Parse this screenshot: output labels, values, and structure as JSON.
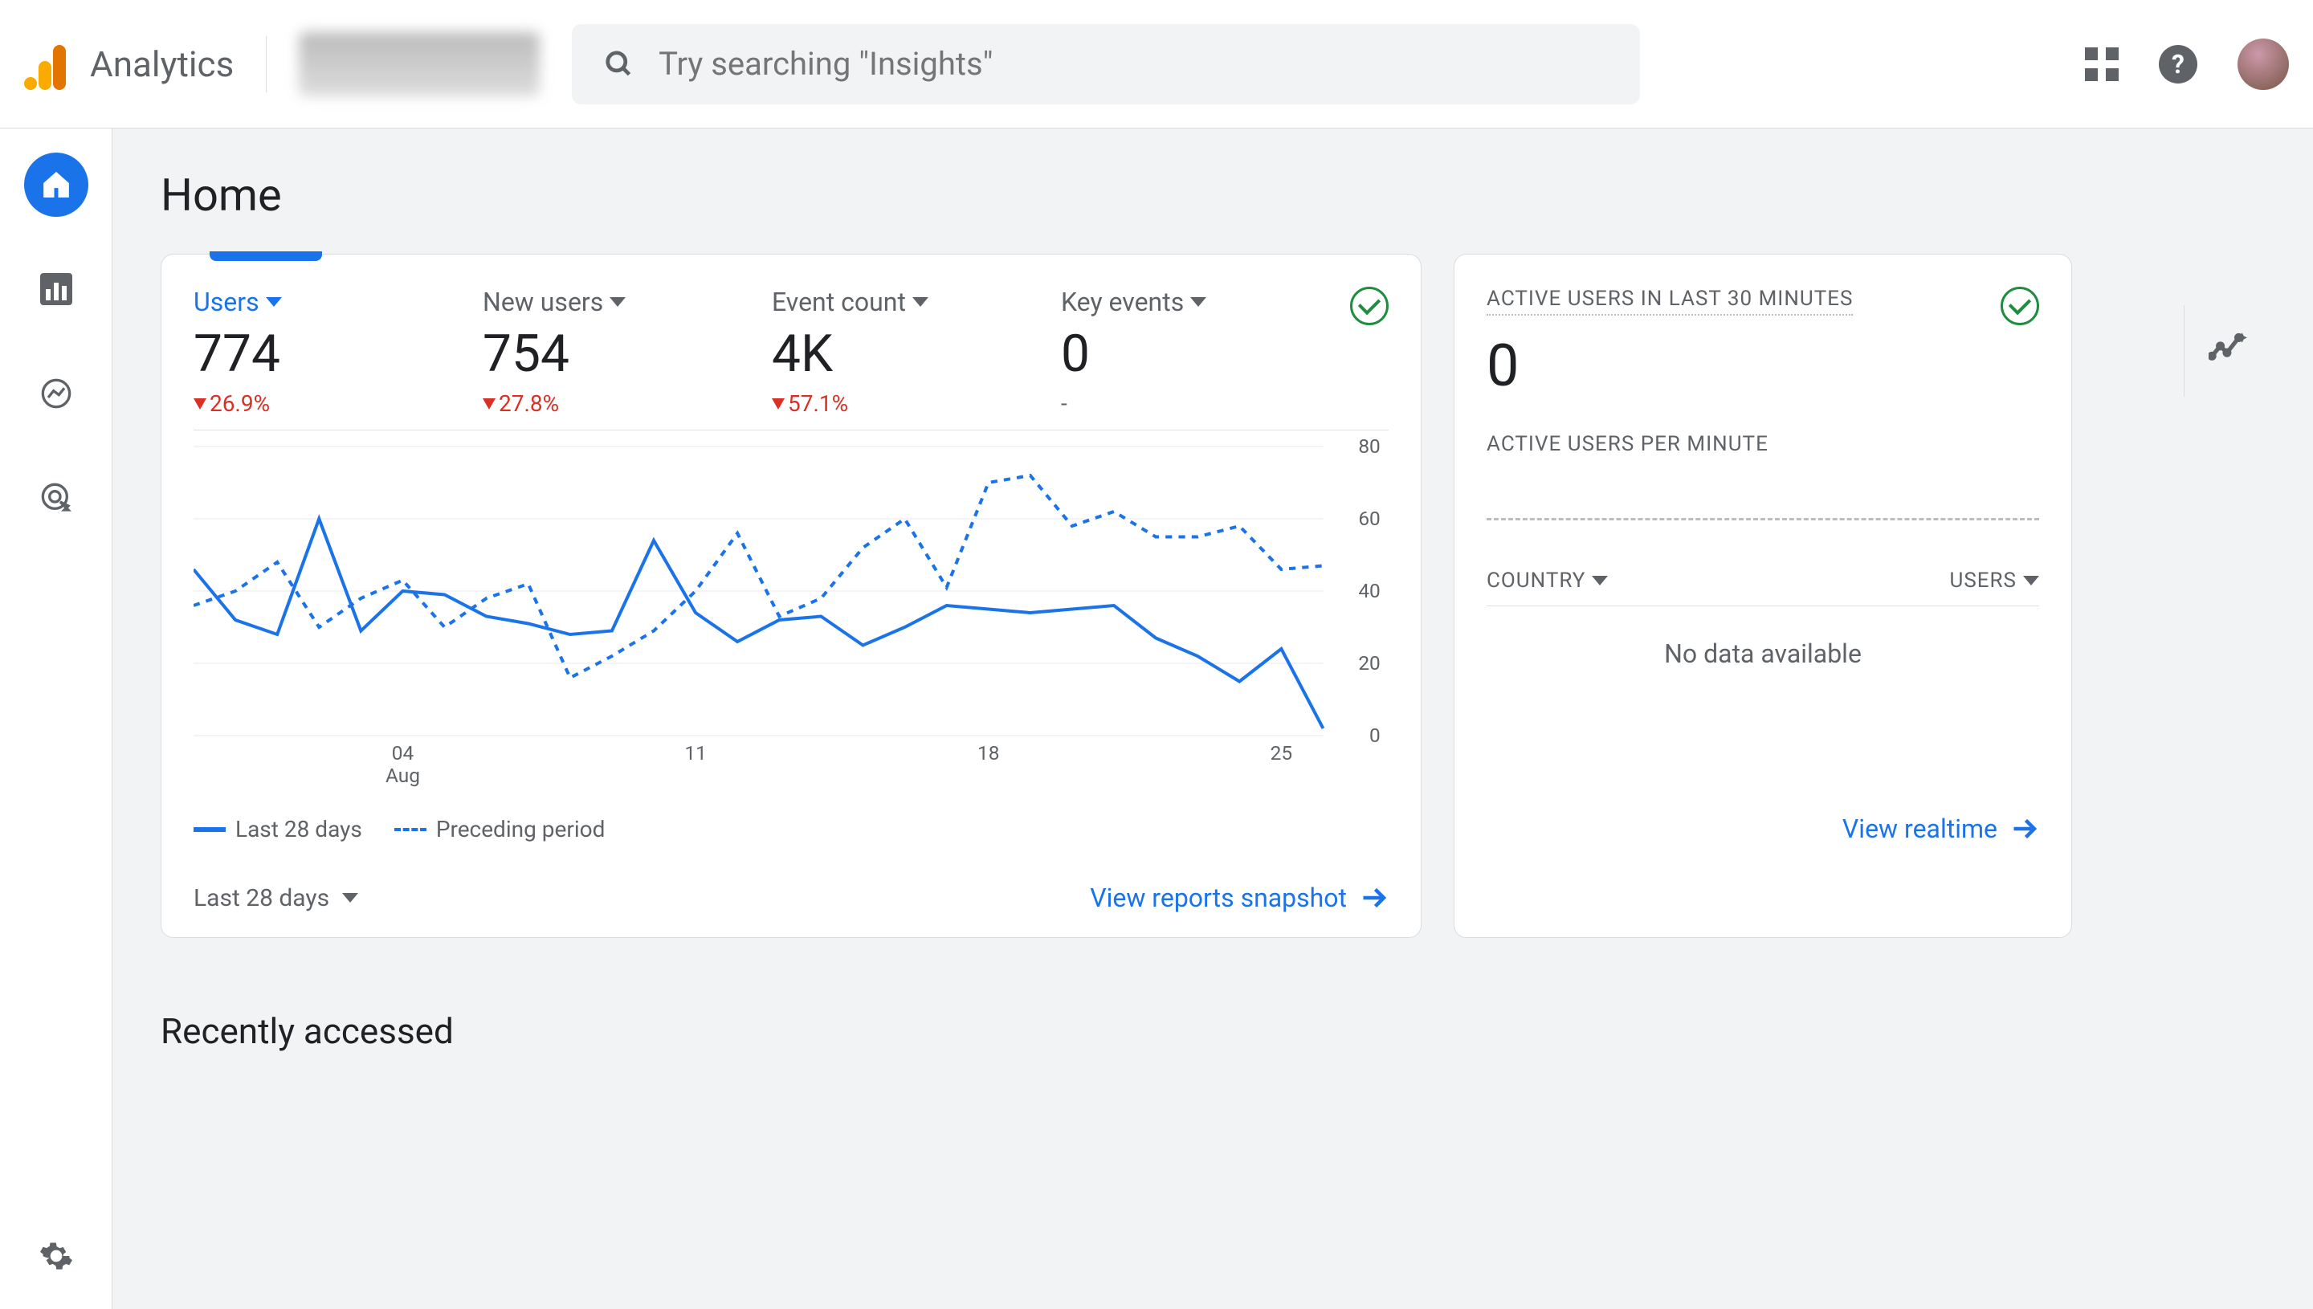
{
  "header": {
    "brand": "Analytics",
    "search_placeholder": "Try searching \"Insights\""
  },
  "page": {
    "title": "Home",
    "recently_accessed": "Recently accessed"
  },
  "metrics": [
    {
      "label": "Users",
      "value": "774",
      "delta": "26.9%",
      "direction": "down",
      "primary": true
    },
    {
      "label": "New users",
      "value": "754",
      "delta": "27.8%",
      "direction": "down",
      "primary": false
    },
    {
      "label": "Event count",
      "value": "4K",
      "delta": "57.1%",
      "direction": "down",
      "primary": false
    },
    {
      "label": "Key events",
      "value": "0",
      "delta": "-",
      "direction": "none",
      "primary": false
    }
  ],
  "chart_data": {
    "type": "line",
    "title": "",
    "xlabel": "",
    "ylabel": "",
    "ylim": [
      0,
      80
    ],
    "x_ticks": [
      "04\nAug",
      "11",
      "18",
      "25"
    ],
    "y_ticks": [
      0,
      20,
      40,
      60,
      80
    ],
    "x_idx": [
      0,
      1,
      2,
      3,
      4,
      5,
      6,
      7,
      8,
      9,
      10,
      11,
      12,
      13,
      14,
      15,
      16,
      17,
      18,
      19,
      20,
      21,
      22,
      23,
      24,
      25,
      26,
      27
    ],
    "series": [
      {
        "name": "Last 28 days",
        "style": "solid",
        "values": [
          46,
          32,
          28,
          60,
          29,
          40,
          39,
          33,
          31,
          28,
          29,
          54,
          34,
          26,
          32,
          33,
          25,
          30,
          36,
          35,
          34,
          35,
          36,
          27,
          22,
          15,
          24,
          2
        ]
      },
      {
        "name": "Preceding period",
        "style": "dashed",
        "values": [
          36,
          40,
          48,
          30,
          38,
          43,
          30,
          38,
          42,
          16,
          22,
          29,
          40,
          56,
          33,
          38,
          52,
          60,
          41,
          70,
          72,
          58,
          62,
          55,
          55,
          58,
          46,
          47
        ]
      }
    ],
    "legend": [
      "Last 28 days",
      "Preceding period"
    ]
  },
  "main_card": {
    "range_label": "Last 28 days",
    "link": "View reports snapshot"
  },
  "realtime": {
    "title": "ACTIVE USERS IN LAST 30 MINUTES",
    "value": "0",
    "subtitle": "ACTIVE USERS PER MINUTE",
    "col_country": "COUNTRY",
    "col_users": "USERS",
    "empty": "No data available",
    "link": "View realtime"
  }
}
